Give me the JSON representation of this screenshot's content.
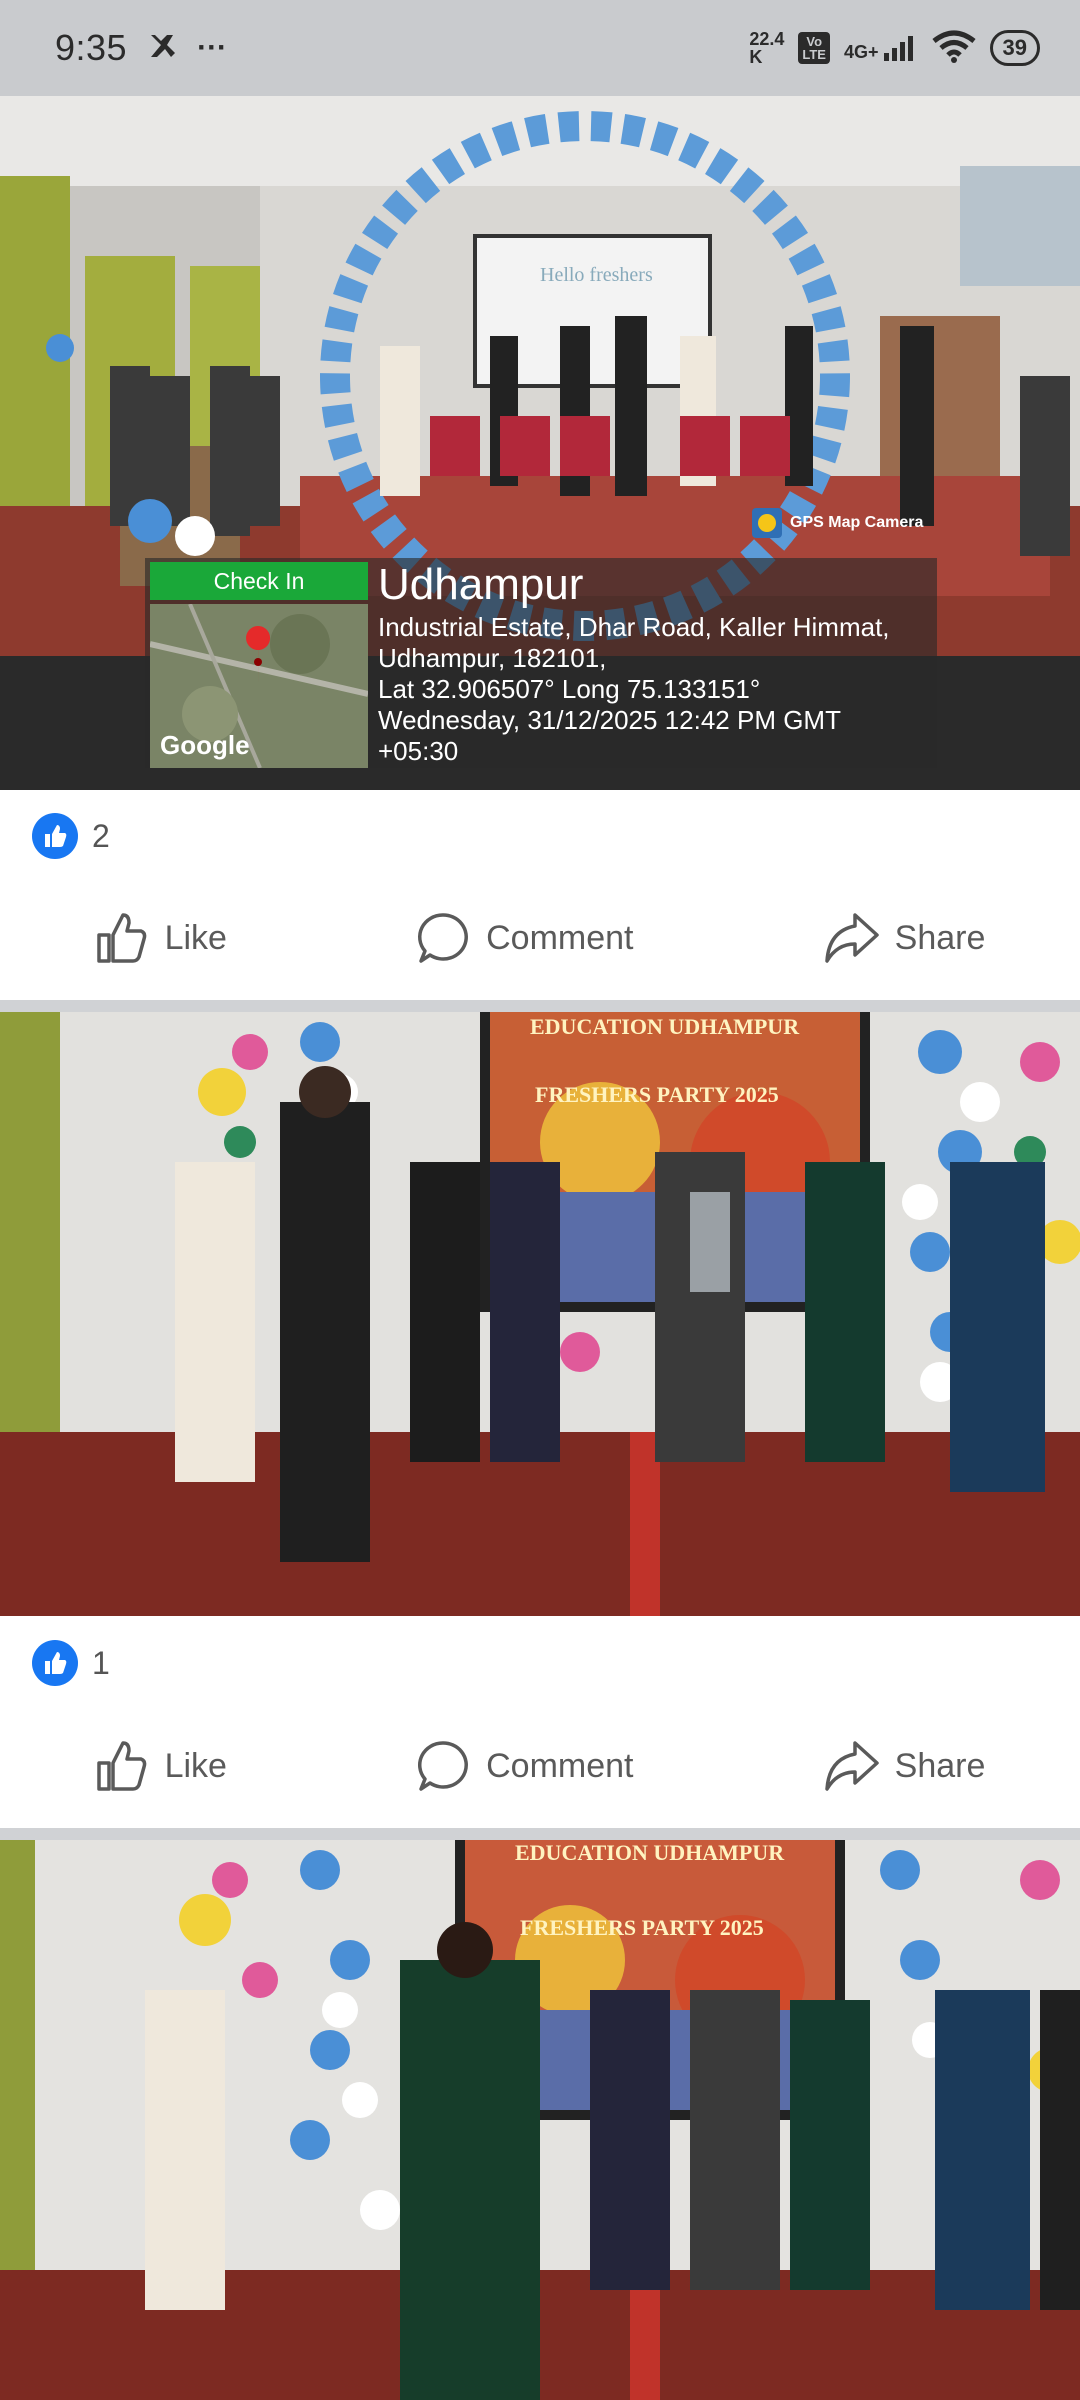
{
  "status_bar": {
    "time": "9:35",
    "overflow": "···",
    "net_speed_value": "22.4",
    "net_speed_unit": "K",
    "volte_top": "Vo",
    "volte_bottom": "LTE",
    "network": "4G+",
    "battery": "39"
  },
  "posts": [
    {
      "gps": {
        "brand": "GPS Map Camera",
        "check_in": "Check In",
        "map_label": "Google",
        "city": "Udhampur",
        "line1": "Industrial Estate, Dhar Road, Kaller Himmat,",
        "line2": "Udhampur, 182101,",
        "line3": "Lat 32.906507° Long 75.133151°",
        "line4": "Wednesday, 31/12/2025 12:42 PM GMT",
        "line5": "+05:30"
      },
      "screen_text": "Hello freshers",
      "reactions": "2"
    },
    {
      "screen_title": "EDUCATION UDHAMPUR",
      "screen_sub": "FRESHERS PARTY 2025",
      "reactions": "1"
    },
    {
      "screen_title": "EDUCATION UDHAMPUR",
      "screen_sub": "FRESHERS PARTY 2025"
    }
  ],
  "actions": {
    "like": "Like",
    "comment": "Comment",
    "share": "Share"
  },
  "colors": {
    "facebook_blue": "#1877f2",
    "checkin_green": "#1aa839",
    "divider": "#d0d2d5"
  }
}
